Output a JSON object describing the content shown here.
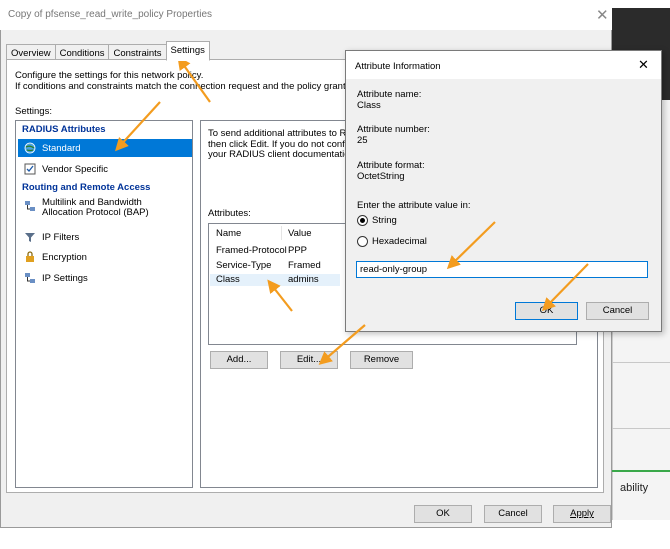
{
  "window": {
    "title": "Copy of pfsense_read_write_policy Properties",
    "close_glyph": "✕"
  },
  "tabs": [
    {
      "label": "Overview"
    },
    {
      "label": "Conditions"
    },
    {
      "label": "Constraints"
    },
    {
      "label": "Settings",
      "active": true
    }
  ],
  "description": {
    "line1": "Configure the settings for this network policy.",
    "line2": "If conditions and constraints match the connection request and the policy grants access, settings are applied."
  },
  "settings_label": "Settings:",
  "tree": {
    "radius_header": "RADIUS Attributes",
    "radius_items": [
      {
        "label": "Standard",
        "icon": "globe-icon",
        "selected": true
      },
      {
        "label": "Vendor Specific",
        "icon": "checkbox-icon"
      }
    ],
    "routing_header": "Routing and Remote Access",
    "routing_items": [
      {
        "label": "Multilink and Bandwidth",
        "label2": "Allocation Protocol (BAP)",
        "icon": "network-icon"
      },
      {
        "label": "IP Filters",
        "icon": "filter-icon"
      },
      {
        "label": "Encryption",
        "icon": "lock-icon"
      },
      {
        "label": "IP Settings",
        "icon": "network-icon"
      }
    ]
  },
  "right_pane": {
    "instr_line1": "To send additional attributes to RA",
    "instr_line2": "then click Edit. If you do not config",
    "instr_line3": "your RADIUS client documentation",
    "attributes_label": "Attributes:",
    "columns": [
      "Name",
      "Value"
    ],
    "rows": [
      {
        "name": "Framed-Protocol",
        "value": "PPP"
      },
      {
        "name": "Service-Type",
        "value": "Framed"
      },
      {
        "name": "Class",
        "value": "admins"
      }
    ],
    "add_label": "Add...",
    "edit_label": "Edit...",
    "remove_label": "Remove"
  },
  "footer": {
    "ok_label": "OK",
    "cancel_label": "Cancel",
    "apply_label": "Apply"
  },
  "attribute_dialog": {
    "title": "Attribute Information",
    "close_glyph": "✕",
    "name_label": "Attribute name:",
    "name_value": "Class",
    "number_label": "Attribute number:",
    "number_value": "25",
    "format_label": "Attribute format:",
    "format_value": "OctetString",
    "enter_label": "Enter the attribute value in:",
    "radio_string": "String",
    "radio_hex": "Hexadecimal",
    "value": "read-only-group",
    "ok_label": "OK",
    "cancel_label": "Cancel"
  },
  "background": {
    "partial_text": "ability"
  },
  "colors": {
    "selection": "#0078d7",
    "annotation_arrow": "#f39c1f",
    "tree_header": "#003399"
  }
}
